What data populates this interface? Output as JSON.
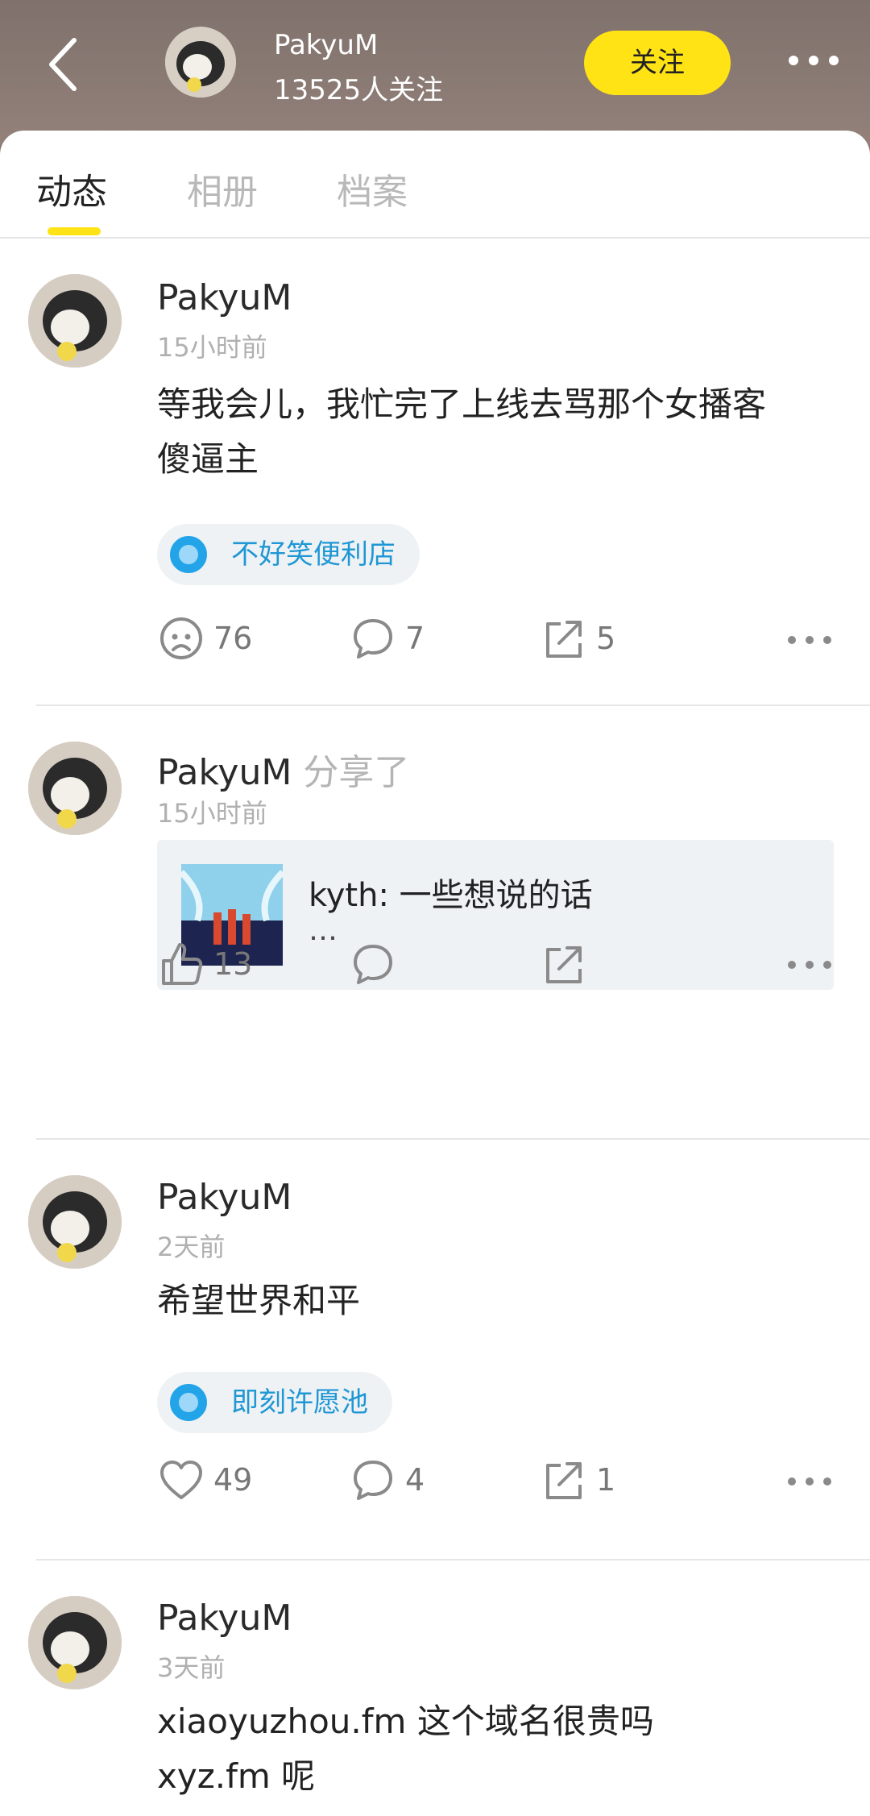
{
  "header": {
    "name": "PakyuM",
    "followers": "13525人关注",
    "follow_label": "关注"
  },
  "tabs": [
    {
      "label": "动态",
      "active": true
    },
    {
      "label": "相册",
      "active": false
    },
    {
      "label": "档案",
      "active": false
    }
  ],
  "posts": [
    {
      "name": "PakyuM",
      "time": "15小时前",
      "text_line1": "等我会儿，我忙完了上线去骂那个女播客",
      "text_line2": "傻逼主",
      "tag": "不好笑便利店",
      "reaction_count": "76",
      "comment_count": "7",
      "share_count": "5"
    },
    {
      "name": "PakyuM",
      "shared_label": "分享了",
      "time": "15小时前",
      "share_title": "kyth: 一些想说的话",
      "share_sub": "…",
      "like_count": "13"
    },
    {
      "name": "PakyuM",
      "time": "2天前",
      "text_line1": "希望世界和平",
      "tag": "即刻许愿池",
      "like_count": "49",
      "comment_count": "4",
      "share_count": "1"
    },
    {
      "name": "PakyuM",
      "time": "3天前",
      "text_line1": "xiaoyuzhou.fm 这个域名很贵吗",
      "text_line2": "xyz.fm 呢"
    }
  ],
  "colors": {
    "accent": "#ffe315",
    "header_bg": "#8a7a73",
    "tag_text": "#1f97d4"
  }
}
